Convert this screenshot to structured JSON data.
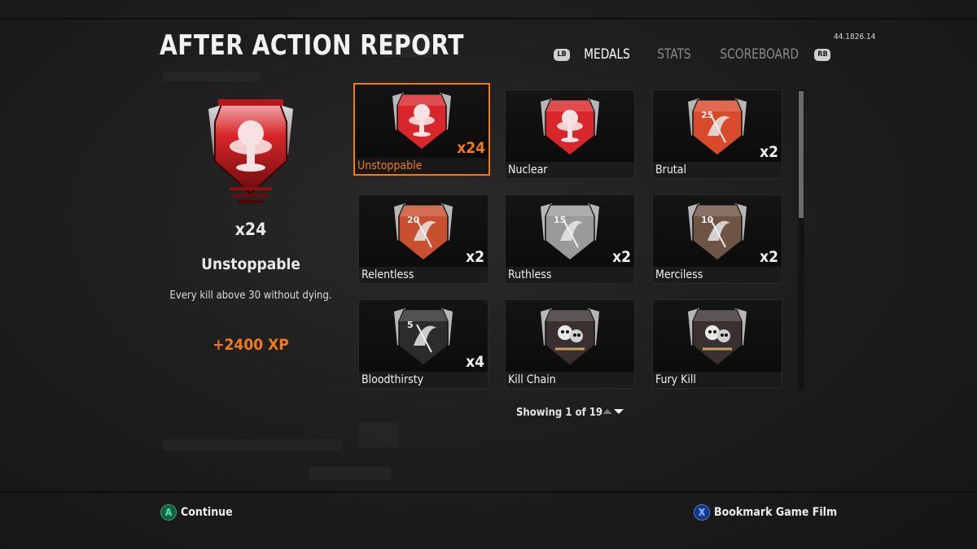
{
  "header": {
    "title": "AFTER ACTION REPORT",
    "version": "44.1826.14",
    "tabs": [
      {
        "label": "MEDALS",
        "active": true
      },
      {
        "label": "STATS",
        "active": false
      },
      {
        "label": "SCOREBOARD",
        "active": false
      }
    ],
    "left_bumper": "LB",
    "right_bumper": "RB"
  },
  "detail": {
    "count": "x24",
    "name": "Unstoppable",
    "description": "Every kill above 30 without dying.",
    "xp": "+2400 XP",
    "medal_icon": "unstoppable-nuke-medal-icon"
  },
  "medals": [
    {
      "name": "Unstoppable",
      "count": "x24",
      "selected": true,
      "color": "#d8262a",
      "number": "",
      "icon": "nuke-cloud-medal-icon"
    },
    {
      "name": "Nuclear",
      "count": "",
      "selected": false,
      "color": "#d8262a",
      "number": "",
      "icon": "nuke-cloud-medal-icon"
    },
    {
      "name": "Brutal",
      "count": "x2",
      "selected": false,
      "color": "#d84a2a",
      "number": "25",
      "icon": "reaper-medal-icon"
    },
    {
      "name": "Relentless",
      "count": "x2",
      "selected": false,
      "color": "#c8502e",
      "number": "20",
      "icon": "reaper-medal-icon"
    },
    {
      "name": "Ruthless",
      "count": "x2",
      "selected": false,
      "color": "#9a9a9a",
      "number": "15",
      "icon": "reaper-medal-icon"
    },
    {
      "name": "Merciless",
      "count": "x2",
      "selected": false,
      "color": "#6e5444",
      "number": "10",
      "icon": "reaper-medal-icon"
    },
    {
      "name": "Bloodthirsty",
      "count": "x4",
      "selected": false,
      "color": "#2c2c2c",
      "number": "5",
      "icon": "reaper-medal-icon"
    },
    {
      "name": "Kill Chain",
      "count": "",
      "selected": false,
      "color": "#3a3030",
      "number": "",
      "icon": "skull-chain-medal-icon"
    },
    {
      "name": "Fury Kill",
      "count": "",
      "selected": false,
      "color": "#3a3030",
      "number": "",
      "icon": "skulls-medal-icon"
    }
  ],
  "pagination": {
    "text": "Showing 1 of 19"
  },
  "footer": {
    "continue_button": "A",
    "continue_label": "Continue",
    "bookmark_button": "X",
    "bookmark_label": "Bookmark Game Film"
  },
  "colors": {
    "accent": "#f07a1e",
    "background": "#1e1e1e"
  }
}
